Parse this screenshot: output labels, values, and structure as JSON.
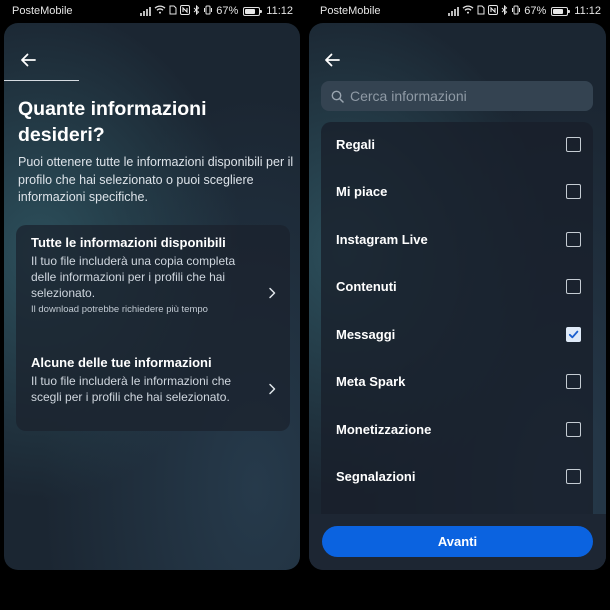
{
  "statusbar": {
    "carrier": "PosteMobile",
    "battery_percent": "67%",
    "battery_level": 0.67,
    "time": "11:12"
  },
  "left_screen": {
    "title": "Quante informazioni desideri?",
    "description": "Puoi ottenere tutte le informazioni disponibili per il profilo che hai selezionato o puoi scegliere informazioni specifiche.",
    "options": [
      {
        "title": "Tutte le informazioni disponibili",
        "description": "Il tuo file includerà una copia completa delle informazioni per i profili che hai selezionato.",
        "note": "Il download potrebbe richiedere più tempo"
      },
      {
        "title": "Alcune delle tue informazioni",
        "description": "Il tuo file includerà le informazioni che scegli per i profili che hai selezionato."
      }
    ]
  },
  "right_screen": {
    "search": {
      "placeholder": "Cerca informazioni",
      "value": ""
    },
    "items": [
      {
        "label": "Regali",
        "checked": false
      },
      {
        "label": "Mi piace",
        "checked": false
      },
      {
        "label": "Instagram Live",
        "checked": false
      },
      {
        "label": "Contenuti",
        "checked": false
      },
      {
        "label": "Messaggi",
        "checked": true
      },
      {
        "label": "Meta Spark",
        "checked": false
      },
      {
        "label": "Monetizzazione",
        "checked": false
      },
      {
        "label": "Segnalazioni",
        "checked": false
      }
    ],
    "next_button": "Avanti"
  },
  "icons": {
    "back": "arrow-left-icon",
    "search": "search-icon",
    "chevron": "chevron-right-icon",
    "checkmark": "checkmark-icon"
  },
  "colors": {
    "primary_button": "#0b63e0",
    "card_background": "#1b2632",
    "check_fill": "#dfeaf8",
    "check_mark": "#1a5fcf"
  }
}
